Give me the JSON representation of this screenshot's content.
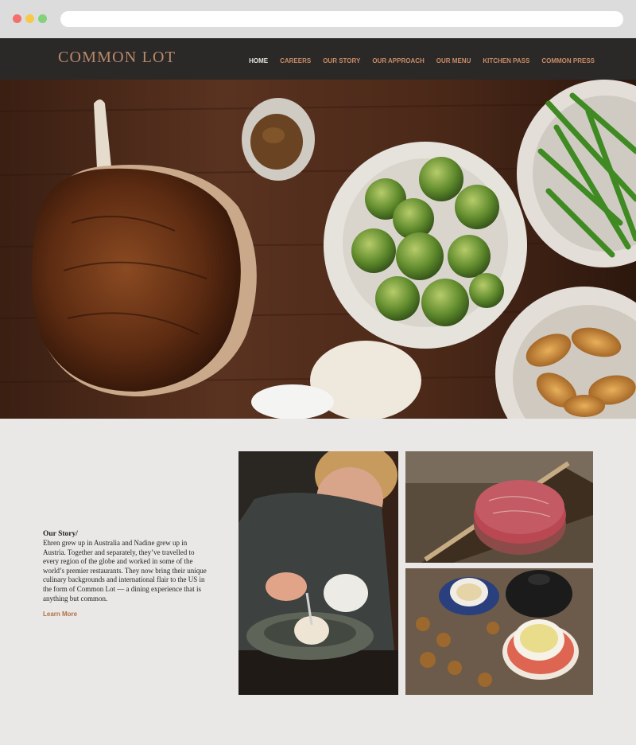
{
  "browser": {
    "controls": [
      "close",
      "minimize",
      "maximize"
    ],
    "url": ""
  },
  "header": {
    "logo": "COMMON LOT",
    "nav": [
      {
        "label": "HOME",
        "active": true
      },
      {
        "label": "CAREERS",
        "active": false
      },
      {
        "label": "OUR STORY",
        "active": false
      },
      {
        "label": "OUR APPROACH",
        "active": false
      },
      {
        "label": "OUR MENU",
        "active": false
      },
      {
        "label": "KITCHEN PASS",
        "active": false
      },
      {
        "label": "COMMON PRESS",
        "active": false
      }
    ]
  },
  "story": {
    "heading": "Our Story/",
    "body": "Ehren grew up in Australia and Nadine grew up in Austria. Together and separately, they’ve travelled to every region of the globe and worked in some of the world’s premier restaurants. They now bring their unique culinary backgrounds and international flair to the US in the form of Common Lot — a dining experience that is anything but common.",
    "link": "Learn More"
  },
  "colors": {
    "header_bg": "#2a2928",
    "logo": "#b9896a",
    "nav_link": "#c98c67",
    "nav_active": "#e9e3dc",
    "page_bg": "#e9e8e6",
    "learn_more": "#b07048"
  }
}
